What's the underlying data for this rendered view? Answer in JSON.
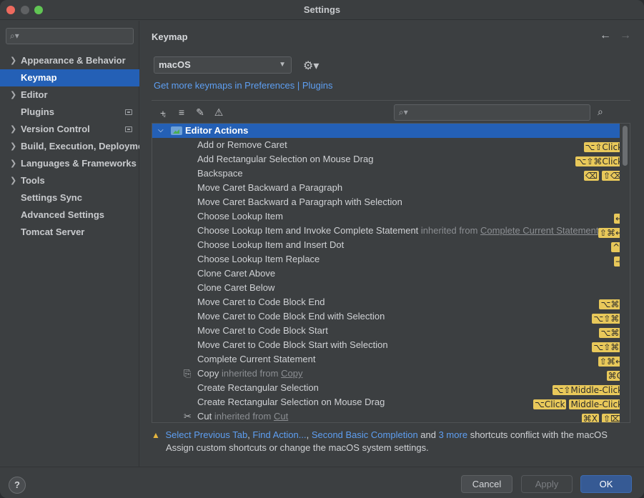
{
  "window": {
    "title": "Settings"
  },
  "sidebar": {
    "search_placeholder": "",
    "items": [
      {
        "label": "Appearance & Behavior",
        "expandable": true,
        "selected": false,
        "badge": false
      },
      {
        "label": "Keymap",
        "expandable": false,
        "selected": true,
        "badge": false
      },
      {
        "label": "Editor",
        "expandable": true,
        "selected": false,
        "badge": false
      },
      {
        "label": "Plugins",
        "expandable": false,
        "selected": false,
        "badge": true
      },
      {
        "label": "Version Control",
        "expandable": true,
        "selected": false,
        "badge": true
      },
      {
        "label": "Build, Execution, Deployment",
        "expandable": true,
        "selected": false,
        "badge": false
      },
      {
        "label": "Languages & Frameworks",
        "expandable": true,
        "selected": false,
        "badge": false
      },
      {
        "label": "Tools",
        "expandable": true,
        "selected": false,
        "badge": false
      },
      {
        "label": "Settings Sync",
        "expandable": false,
        "selected": false,
        "badge": false
      },
      {
        "label": "Advanced Settings",
        "expandable": false,
        "selected": false,
        "badge": false
      },
      {
        "label": "Tomcat Server",
        "expandable": false,
        "selected": false,
        "badge": false
      }
    ]
  },
  "main": {
    "title": "Keymap",
    "keymap_select": "macOS",
    "more_keymaps_link": "Get more keymaps in Preferences | Plugins",
    "toolbar_icons": [
      "expand-all-icon",
      "collapse-all-icon",
      "edit-icon",
      "warning-icon"
    ],
    "filter_placeholder": ""
  },
  "tree": {
    "root_label": "Editor Actions",
    "actions": [
      {
        "label": "Add or Remove Caret",
        "shortcuts": [
          "⌥⇧Click"
        ]
      },
      {
        "label": "Add Rectangular Selection on Mouse Drag",
        "shortcuts": [
          "⌥⇧⌘Click"
        ]
      },
      {
        "label": "Backspace",
        "shortcuts": [
          "⌫",
          "⇧⌫"
        ]
      },
      {
        "label": "Move Caret Backward a Paragraph",
        "shortcuts": []
      },
      {
        "label": "Move Caret Backward a Paragraph with Selection",
        "shortcuts": []
      },
      {
        "label": "Choose Lookup Item",
        "shortcuts": [
          "↩"
        ]
      },
      {
        "label": "Choose Lookup Item and Invoke Complete Statement",
        "inherited_prefix": "inherited from",
        "inherited_from": "Complete Current Statement",
        "shortcuts": [
          "⇧⌘↩"
        ]
      },
      {
        "label": "Choose Lookup Item and Insert Dot",
        "shortcuts": [
          "^."
        ]
      },
      {
        "label": "Choose Lookup Item Replace",
        "shortcuts": [
          "⇥"
        ]
      },
      {
        "label": "Clone Caret Above",
        "shortcuts": []
      },
      {
        "label": "Clone Caret Below",
        "shortcuts": []
      },
      {
        "label": "Move Caret to Code Block End",
        "shortcuts": [
          "⌥⌘]"
        ]
      },
      {
        "label": "Move Caret to Code Block End with Selection",
        "shortcuts": [
          "⌥⇧⌘]"
        ]
      },
      {
        "label": "Move Caret to Code Block Start",
        "shortcuts": [
          "⌥⌘["
        ]
      },
      {
        "label": "Move Caret to Code Block Start with Selection",
        "shortcuts": [
          "⌥⇧⌘["
        ]
      },
      {
        "label": "Complete Current Statement",
        "shortcuts": [
          "⇧⌘↩"
        ]
      },
      {
        "label": "Copy",
        "icon": "copy-icon",
        "inherited_prefix": "inherited from",
        "inherited_from": "Copy",
        "shortcuts": [
          "⌘C"
        ]
      },
      {
        "label": "Create Rectangular Selection",
        "shortcuts": [
          "⌥⇧Middle-Click"
        ]
      },
      {
        "label": "Create Rectangular Selection on Mouse Drag",
        "shortcuts": [
          "⌥Click",
          "Middle-Click"
        ]
      },
      {
        "label": "Cut",
        "icon": "cut-icon",
        "inherited_prefix": "inherited from",
        "inherited_from": "Cut",
        "shortcuts": [
          "⌘X",
          "⇧⌦"
        ]
      }
    ]
  },
  "warning": {
    "links": [
      "Select Previous Tab",
      "Find Action...",
      "Second Basic Completion",
      "3 more"
    ],
    "text_a": "shortcuts conflict with the macOS",
    "line2": "Assign custom shortcuts or change the macOS system settings."
  },
  "footer": {
    "help": "?",
    "cancel": "Cancel",
    "apply": "Apply",
    "ok": "OK"
  },
  "colors": {
    "selection": "#2460b6",
    "link": "#5e9ff2",
    "shortcut_bg": "#e8c85a",
    "warning": "#e5b53e",
    "ok_button": "#365a94"
  }
}
